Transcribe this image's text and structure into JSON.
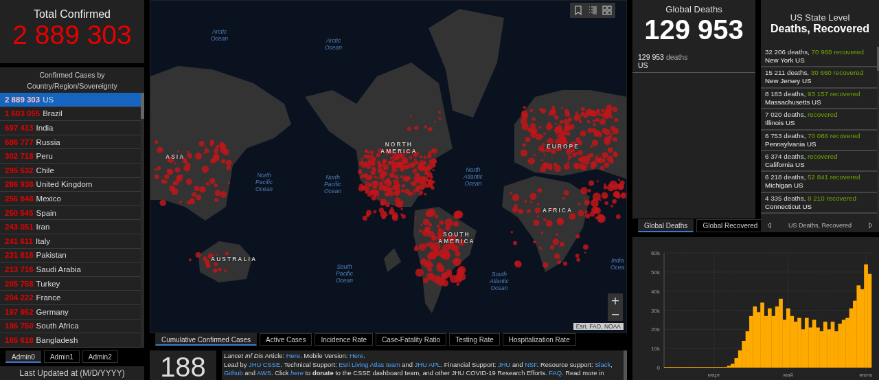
{
  "total_confirmed": {
    "title": "Total Confirmed",
    "value": "2 889 303"
  },
  "country_list": {
    "title": "Confirmed Cases by Country/Region/Sovereignty",
    "rows": [
      {
        "count": "2 889 303",
        "name": "US",
        "selected": true
      },
      {
        "count": "1 603 055",
        "name": "Brazil",
        "selected": false
      },
      {
        "count": "697 413",
        "name": "India",
        "selected": false
      },
      {
        "count": "686 777",
        "name": "Russia",
        "selected": false
      },
      {
        "count": "302 718",
        "name": "Peru",
        "selected": false
      },
      {
        "count": "295 532",
        "name": "Chile",
        "selected": false
      },
      {
        "count": "286 938",
        "name": "United Kingdom",
        "selected": false
      },
      {
        "count": "256 848",
        "name": "Mexico",
        "selected": false
      },
      {
        "count": "250 545",
        "name": "Spain",
        "selected": false
      },
      {
        "count": "243 051",
        "name": "Iran",
        "selected": false
      },
      {
        "count": "241 611",
        "name": "Italy",
        "selected": false
      },
      {
        "count": "231 818",
        "name": "Pakistan",
        "selected": false
      },
      {
        "count": "213 716",
        "name": "Saudi Arabia",
        "selected": false
      },
      {
        "count": "205 758",
        "name": "Turkey",
        "selected": false
      },
      {
        "count": "204 222",
        "name": "France",
        "selected": false
      },
      {
        "count": "197 952",
        "name": "Germany",
        "selected": false
      },
      {
        "count": "196 750",
        "name": "South Africa",
        "selected": false
      },
      {
        "count": "165 618",
        "name": "Bangladesh",
        "selected": false
      }
    ]
  },
  "admin_tabs": [
    {
      "label": "Admin0",
      "selected": true
    },
    {
      "label": "Admin1",
      "selected": false
    },
    {
      "label": "Admin2",
      "selected": false
    }
  ],
  "last_updated": {
    "label": "Last Updated at (M/D/YYYY)"
  },
  "map": {
    "labels": [
      {
        "text": "Arctic Ocean",
        "kind": "ocean"
      },
      {
        "text": "Arctic Ocean",
        "kind": "ocean"
      },
      {
        "text": "ASIA",
        "kind": "continent"
      },
      {
        "text": "North Pacific Ocean",
        "kind": "ocean"
      },
      {
        "text": "North Pacific Ocean",
        "kind": "ocean"
      },
      {
        "text": "NORTH AMERICA",
        "kind": "continent"
      },
      {
        "text": "North Atlantic Ocean",
        "kind": "ocean"
      },
      {
        "text": "EUROPE",
        "kind": "continent"
      },
      {
        "text": "AFRICA",
        "kind": "continent"
      },
      {
        "text": "SOUTH AMERICA",
        "kind": "continent"
      },
      {
        "text": "AUSTRALIA",
        "kind": "continent"
      },
      {
        "text": "South Pacific Ocean",
        "kind": "ocean"
      },
      {
        "text": "South Atlantic Ocean",
        "kind": "ocean"
      },
      {
        "text": "India Ocea",
        "kind": "ocean"
      }
    ],
    "attribution": "Esri, FAO, NOAA",
    "zoom_in": "+",
    "zoom_out": "−"
  },
  "map_tabs": [
    {
      "label": "Cumulative Confirmed Cases",
      "selected": true
    },
    {
      "label": "Active Cases",
      "selected": false
    },
    {
      "label": "Incidence Rate",
      "selected": false
    },
    {
      "label": "Case-Fatality Ratio",
      "selected": false
    },
    {
      "label": "Testing Rate",
      "selected": false
    },
    {
      "label": "Hospitalization Rate",
      "selected": false
    }
  ],
  "counter": {
    "value": "188"
  },
  "info": {
    "paragraphs": [
      [
        {
          "text": "Lancet Inf Dis",
          "kind": "italic"
        },
        {
          "text": " Article: ",
          "kind": "plain"
        },
        {
          "text": "Here",
          "kind": "link"
        },
        {
          "text": ". Mobile Version: ",
          "kind": "plain"
        },
        {
          "text": "Here",
          "kind": "link"
        },
        {
          "text": ".",
          "kind": "plain"
        }
      ],
      [
        {
          "text": "Lead by ",
          "kind": "plain"
        },
        {
          "text": "JHU CSSE",
          "kind": "link"
        },
        {
          "text": ". Technical Support: ",
          "kind": "plain"
        },
        {
          "text": "Esri Living Atlas team",
          "kind": "link"
        },
        {
          "text": " and ",
          "kind": "plain"
        },
        {
          "text": "JHU APL",
          "kind": "link"
        },
        {
          "text": ". Financial Support: ",
          "kind": "plain"
        },
        {
          "text": "JHU",
          "kind": "link"
        },
        {
          "text": " and ",
          "kind": "plain"
        },
        {
          "text": "NSF",
          "kind": "link"
        },
        {
          "text": ". Resource support: ",
          "kind": "plain"
        },
        {
          "text": "Slack",
          "kind": "link"
        },
        {
          "text": ", ",
          "kind": "plain"
        },
        {
          "text": "Github",
          "kind": "link"
        },
        {
          "text": " and ",
          "kind": "plain"
        },
        {
          "text": "AWS",
          "kind": "link"
        },
        {
          "text": ". Click ",
          "kind": "plain"
        },
        {
          "text": "here",
          "kind": "italic-link"
        },
        {
          "text": " to ",
          "kind": "plain"
        },
        {
          "text": "donate",
          "kind": "bold"
        },
        {
          "text": " to the CSSE dashboard team, and other JHU COVID-19 Research Efforts. ",
          "kind": "plain"
        },
        {
          "text": "FAQ",
          "kind": "link"
        },
        {
          "text": ". Read more in",
          "kind": "plain"
        }
      ]
    ]
  },
  "global_deaths": {
    "title": "Global Deaths",
    "value": "129 953",
    "items": [
      {
        "count": "129 953",
        "unit": "deaths",
        "place": "US"
      }
    ]
  },
  "deaths_tabs": [
    {
      "label": "Global Deaths",
      "selected": true
    },
    {
      "label": "Global Recovered",
      "selected": false
    }
  ],
  "us_states": {
    "subtitle": "US State Level",
    "title": "Deaths, Recovered",
    "items": [
      {
        "deaths": "32 206 deaths,",
        "recovered": "70 968",
        "recovered_label": "recovered",
        "place": "New York US"
      },
      {
        "deaths": "15 211 deaths,",
        "recovered": "30 660",
        "recovered_label": "recovered",
        "place": "New Jersey US"
      },
      {
        "deaths": "8 183 deaths,",
        "recovered": "93 157",
        "recovered_label": "recovered",
        "place": "Massachusetts US"
      },
      {
        "deaths": "7 020 deaths,",
        "recovered_label": "recovered",
        "place": "Illinois US"
      },
      {
        "deaths": "6 753 deaths,",
        "recovered": "70 086",
        "recovered_label": "recovered",
        "place": "Pennsylvania US"
      },
      {
        "deaths": "6 374 deaths,",
        "recovered_label": "recovered",
        "place": "California US"
      },
      {
        "deaths": "6 218 deaths,",
        "recovered": "52 841",
        "recovered_label": "recovered",
        "place": "Michigan US"
      },
      {
        "deaths": "4 335 deaths,",
        "recovered": "8 210",
        "recovered_label": "recovered",
        "place": "Connecticut US"
      }
    ],
    "nav_label": "US Deaths, Recovered"
  },
  "chart": {
    "chart_data": {
      "type": "bar",
      "color": "#ffaa00",
      "categories": [
        null,
        null,
        null,
        null,
        null,
        null,
        null,
        null,
        null,
        null,
        null,
        null,
        null,
        "март",
        null,
        null,
        null,
        null,
        null,
        null,
        null,
        null,
        null,
        null,
        null,
        null,
        null,
        null,
        null,
        null,
        null,
        null,
        null,
        "май",
        null,
        null,
        null,
        null,
        null,
        null,
        null,
        null,
        null,
        null,
        null,
        null,
        null,
        null,
        null,
        null,
        null,
        null,
        null,
        null,
        "июль",
        null
      ],
      "values": [
        0,
        0,
        0,
        0,
        0,
        0,
        0,
        0,
        0,
        0,
        0,
        0,
        0,
        0,
        0,
        0,
        300,
        1000,
        2000,
        5000,
        9000,
        14000,
        19000,
        27000,
        32000,
        29000,
        34000,
        27000,
        31000,
        27000,
        32000,
        36000,
        25000,
        31000,
        27000,
        24000,
        26000,
        20000,
        26000,
        21000,
        25000,
        21000,
        19000,
        24000,
        20000,
        24000,
        19000,
        23000,
        25000,
        26000,
        31000,
        35000,
        43000,
        41000,
        54000,
        49000
      ],
      "ylim": [
        0,
        60000
      ],
      "grid": true,
      "yticks": [
        {
          "value": 0,
          "label": "0"
        },
        {
          "value": 10000,
          "label": "10k"
        },
        {
          "value": 20000,
          "label": "20k"
        },
        {
          "value": 30000,
          "label": "30k"
        },
        {
          "value": 40000,
          "label": "40k"
        },
        {
          "value": 50000,
          "label": "50k"
        },
        {
          "value": 60000,
          "label": "60k"
        }
      ]
    }
  }
}
